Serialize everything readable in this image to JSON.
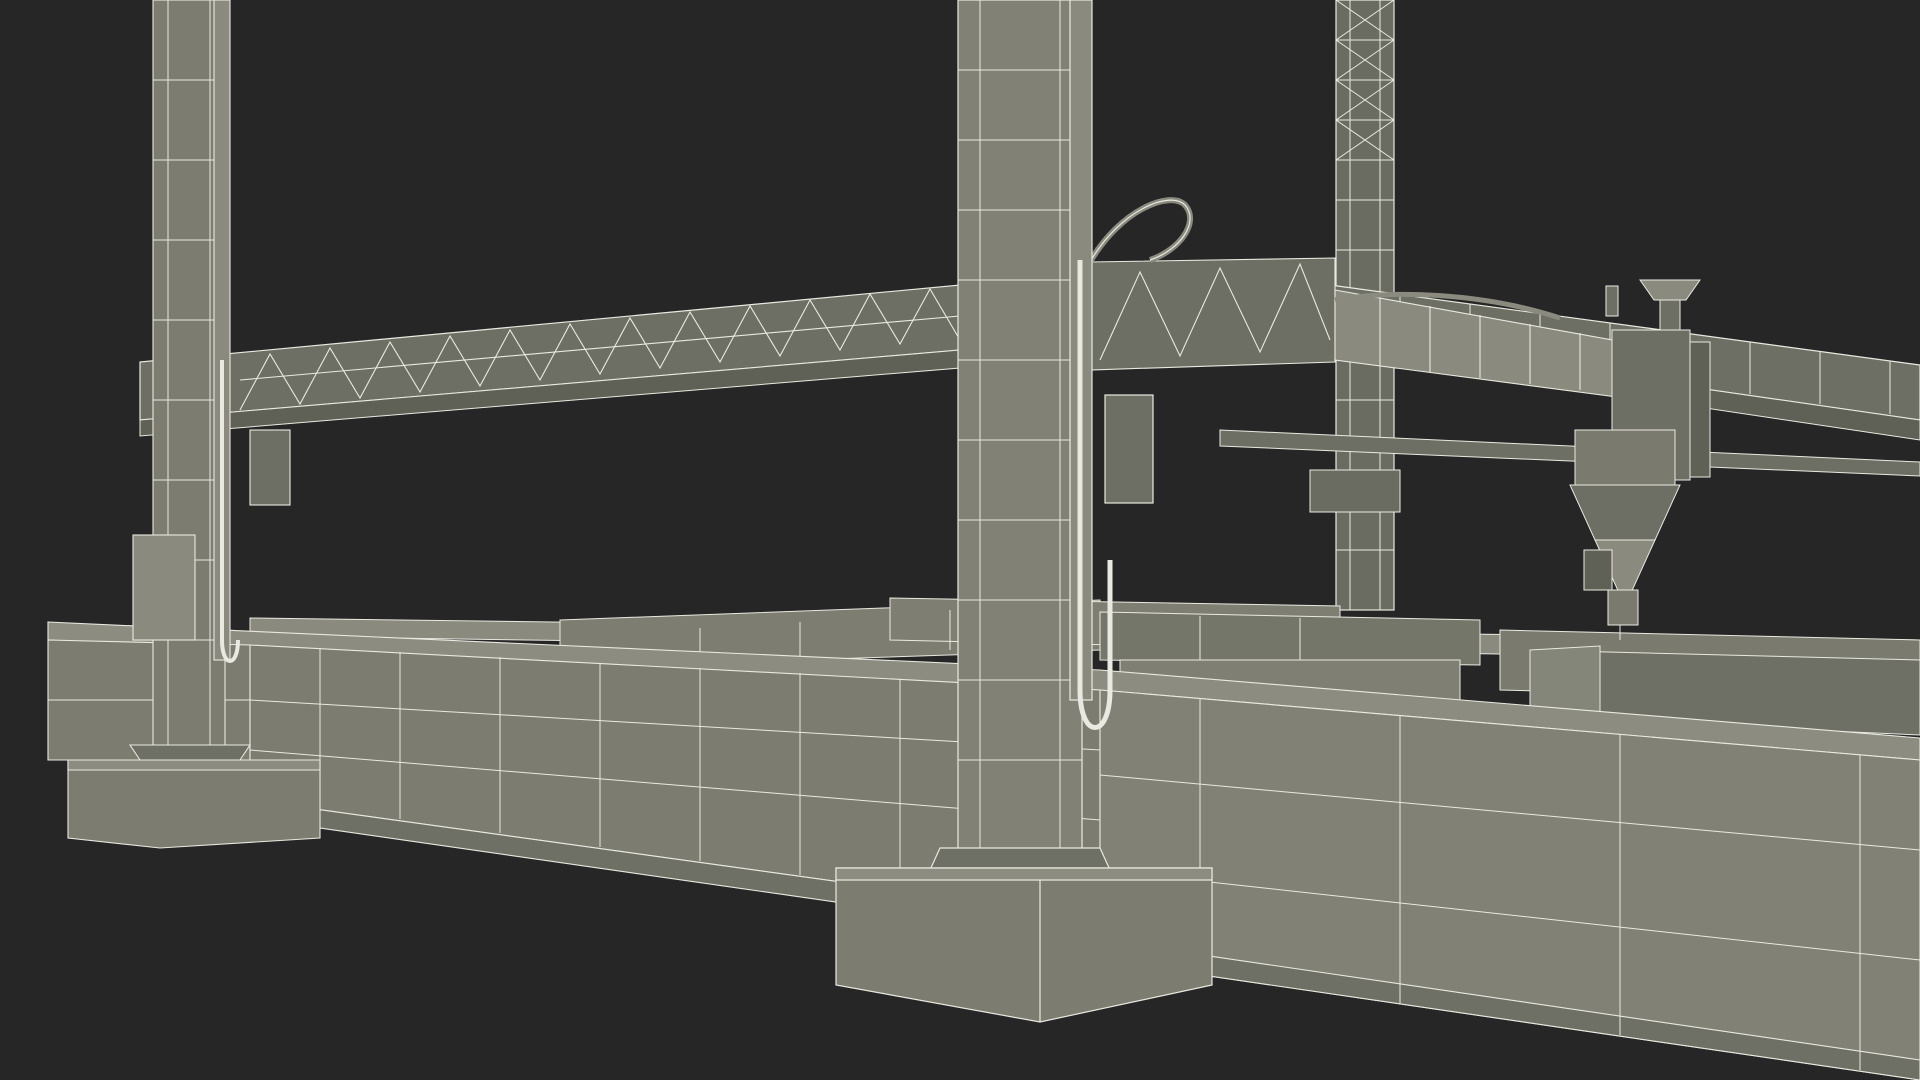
{
  "scene": {
    "subject": "construction-3d-printer-wireframe",
    "colors": {
      "background": "#262626",
      "surface": "#7c7d70",
      "surface_light": "#8c8d80",
      "surface_dark": "#5f6056",
      "wire": "#e9e9e1",
      "truss": "#6e6f64"
    }
  }
}
